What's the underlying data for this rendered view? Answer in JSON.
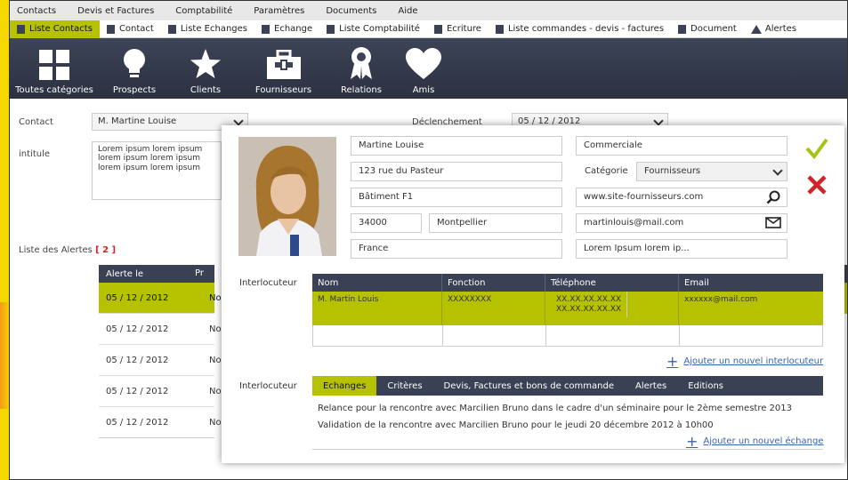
{
  "menu": [
    "Contacts",
    "Devis et Factures",
    "Comptabilité",
    "Paramètres",
    "Documents",
    "Aide"
  ],
  "tabs": [
    {
      "label": "Liste Contacts",
      "active": true
    },
    {
      "label": "Contact"
    },
    {
      "label": "Liste Echanges"
    },
    {
      "label": "Echange"
    },
    {
      "label": "Liste Comptabilité"
    },
    {
      "label": "Ecriture"
    },
    {
      "label": "Liste commandes - devis - factures"
    },
    {
      "label": "Document"
    },
    {
      "label": "Alertes"
    }
  ],
  "toolbar": [
    {
      "label": "Toutes catégories",
      "icon": "grid-icon"
    },
    {
      "label": "Prospects",
      "icon": "lightbulb-icon"
    },
    {
      "label": "Clients",
      "icon": "star-icon"
    },
    {
      "label": "Fournisseurs",
      "icon": "briefcase-icon"
    },
    {
      "label": "Relations",
      "icon": "ribbon-icon"
    },
    {
      "label": "Amis",
      "icon": "heart-icon"
    }
  ],
  "form": {
    "contact_label": "Contact",
    "contact_value": "M. Martine Louise",
    "declenchement_label": "Déclenchement",
    "declenchement_value": "05 / 12 / 2012",
    "intitule_label": "intitule",
    "intitule_value": "Lorem ipsum lorem ipsum lorem ipsum lorem ipsum lorem ipsum lorem ipsum"
  },
  "alerts": {
    "title": "Liste des Alertes",
    "count": "[ 2 ]",
    "header": "Alerte le",
    "header2": "Pr",
    "rows": [
      {
        "date": "05 / 12 / 2012",
        "p": "No"
      },
      {
        "date": "05 / 12 / 2012",
        "p": "No"
      },
      {
        "date": "05 / 12 / 2012",
        "p": "No"
      },
      {
        "date": "05 / 12 / 2012",
        "p": "No"
      },
      {
        "date": "05 / 12 / 2012",
        "p": "No"
      }
    ]
  },
  "modal": {
    "name": "Martine Louise",
    "address1": "123 rue du Pasteur",
    "address2": "Bâtiment F1",
    "zip": "34000",
    "city": "Montpellier",
    "country": "France",
    "role": "Commerciale",
    "category_label": "Catégorie",
    "category_value": "Fournisseurs",
    "website": "www.site-fournisseurs.com",
    "email": "martinlouis@mail.com",
    "note": "Lorem Ipsum lorem ip...",
    "interlocuteur_label": "Interlocuteur",
    "grid_headers": [
      "Nom",
      "Fonction",
      "Téléphone",
      "Email"
    ],
    "grid_rows": [
      {
        "nom": "M. Martin Louis",
        "fonction": "XXXXXXXX",
        "tel1": "XX.XX.XX.XX.XX",
        "tel2": "XX.XX.XX.XX.XX",
        "email": "xxxxxx@mail.com"
      }
    ],
    "add_interlocuteur": "Ajouter un nouvel interlocuteur",
    "subtabs": [
      "Echanges",
      "Critères",
      "Devis, Factures et bons de commande",
      "Alertes",
      "Editions"
    ],
    "exchanges": [
      "Relance pour la rencontre avec Marcilien Bruno dans le cadre d'un séminaire pour le 2ème semestre 2013",
      "Validation de la rencontre avec Marcilien Bruno pour le jeudi 20 décembre 2012 à 10h00"
    ],
    "add_exchange": "Ajouter un nouvel échange"
  },
  "colors": {
    "accent": "#b6c200",
    "dark": "#3a4155",
    "cancel": "#d0232a",
    "confirm": "#a8c21a"
  }
}
